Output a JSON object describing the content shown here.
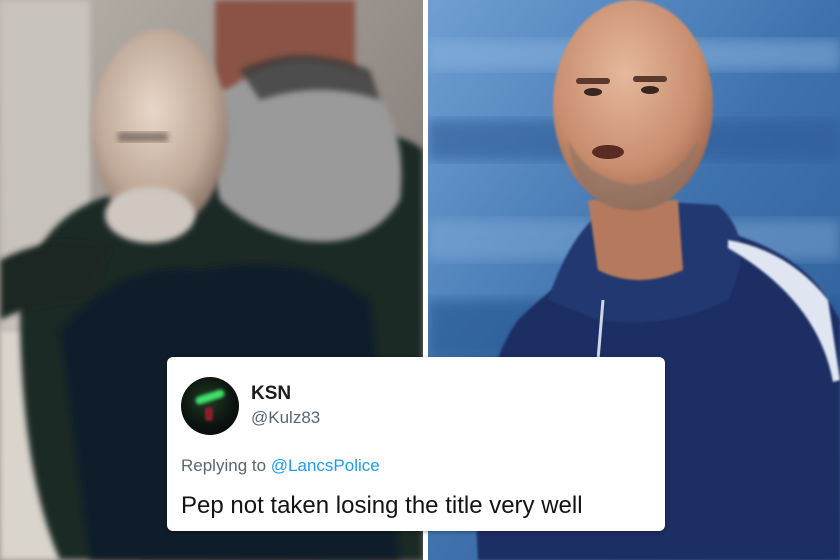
{
  "tweet": {
    "display_name": "KSN",
    "handle": "@Kulz83",
    "replying_prefix": "Replying to",
    "replying_handle": "@LancsPolice",
    "text": "Pep not taken losing the title very well"
  },
  "colors": {
    "mention_blue": "#1d9bf0",
    "hoodie_navy": "#1e2f63",
    "stadium_blue": "#3d6ea8"
  }
}
